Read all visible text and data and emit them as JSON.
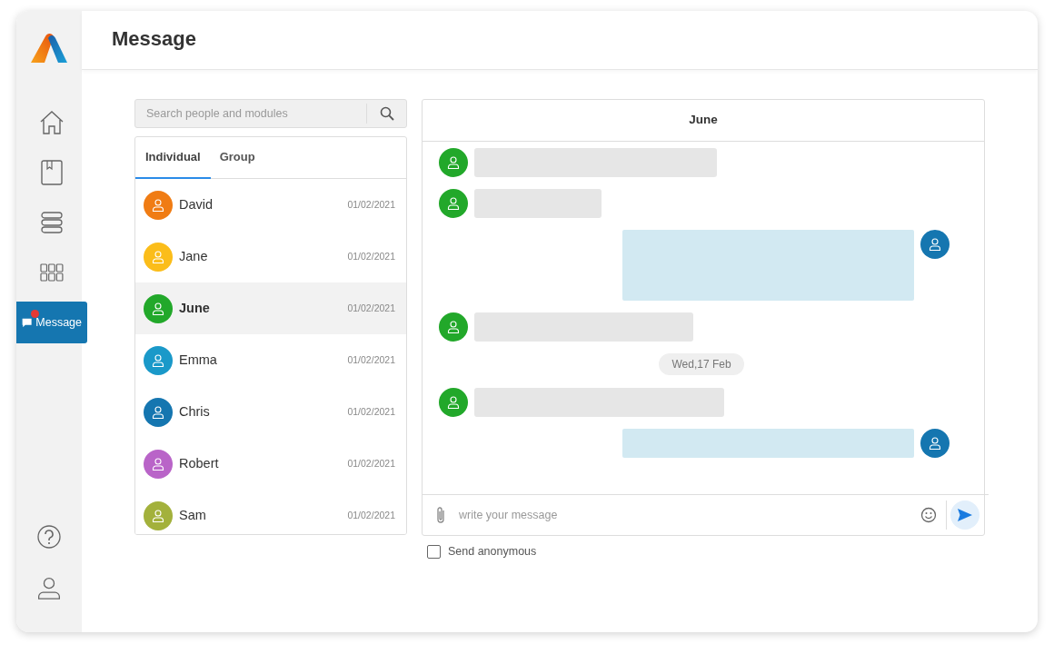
{
  "header": {
    "title": "Message"
  },
  "sidebar": {
    "items": [
      {
        "kind": "home",
        "selected": false,
        "badge": false
      },
      {
        "kind": "book",
        "selected": false,
        "badge": false
      },
      {
        "kind": "list",
        "selected": false,
        "badge": false
      },
      {
        "kind": "grid",
        "selected": false,
        "badge": false
      },
      {
        "kind": "message",
        "label": "Message",
        "selected": true,
        "badge": true
      }
    ],
    "bottom_items": [
      {
        "kind": "help"
      },
      {
        "kind": "profile"
      }
    ]
  },
  "search": {
    "placeholder": "Search people and modules"
  },
  "tabs": [
    {
      "label": "Individual",
      "selected": true
    },
    {
      "label": "Group",
      "selected": false
    }
  ],
  "contacts": [
    {
      "name": "David",
      "date": "01/02/2021",
      "color": "#f07c14",
      "selected": false
    },
    {
      "name": "Jane",
      "date": "01/02/2021",
      "color": "#fbbd1a",
      "selected": false
    },
    {
      "name": "June",
      "date": "01/02/2021",
      "color": "#22a82a",
      "selected": true
    },
    {
      "name": "Emma",
      "date": "01/02/2021",
      "color": "#1a99c9",
      "selected": false
    },
    {
      "name": "Chris",
      "date": "01/02/2021",
      "color": "#1576b0",
      "selected": false
    },
    {
      "name": "Robert",
      "date": "01/02/2021",
      "color": "#b964c8",
      "selected": false
    },
    {
      "name": "Sam",
      "date": "01/02/2021",
      "color": "#a3b13c",
      "selected": false
    }
  ],
  "chat": {
    "title": "June",
    "messages": [
      {
        "kind": "incoming"
      },
      {
        "kind": "incoming"
      },
      {
        "kind": "outgoing"
      },
      {
        "kind": "incoming"
      },
      {
        "kind": "date",
        "text": "Wed,17 Feb"
      },
      {
        "kind": "incoming"
      },
      {
        "kind": "outgoing"
      }
    ],
    "composer": {
      "placeholder": "write your message"
    },
    "anonymous": {
      "label": "Send anonymous",
      "checked": false
    }
  }
}
